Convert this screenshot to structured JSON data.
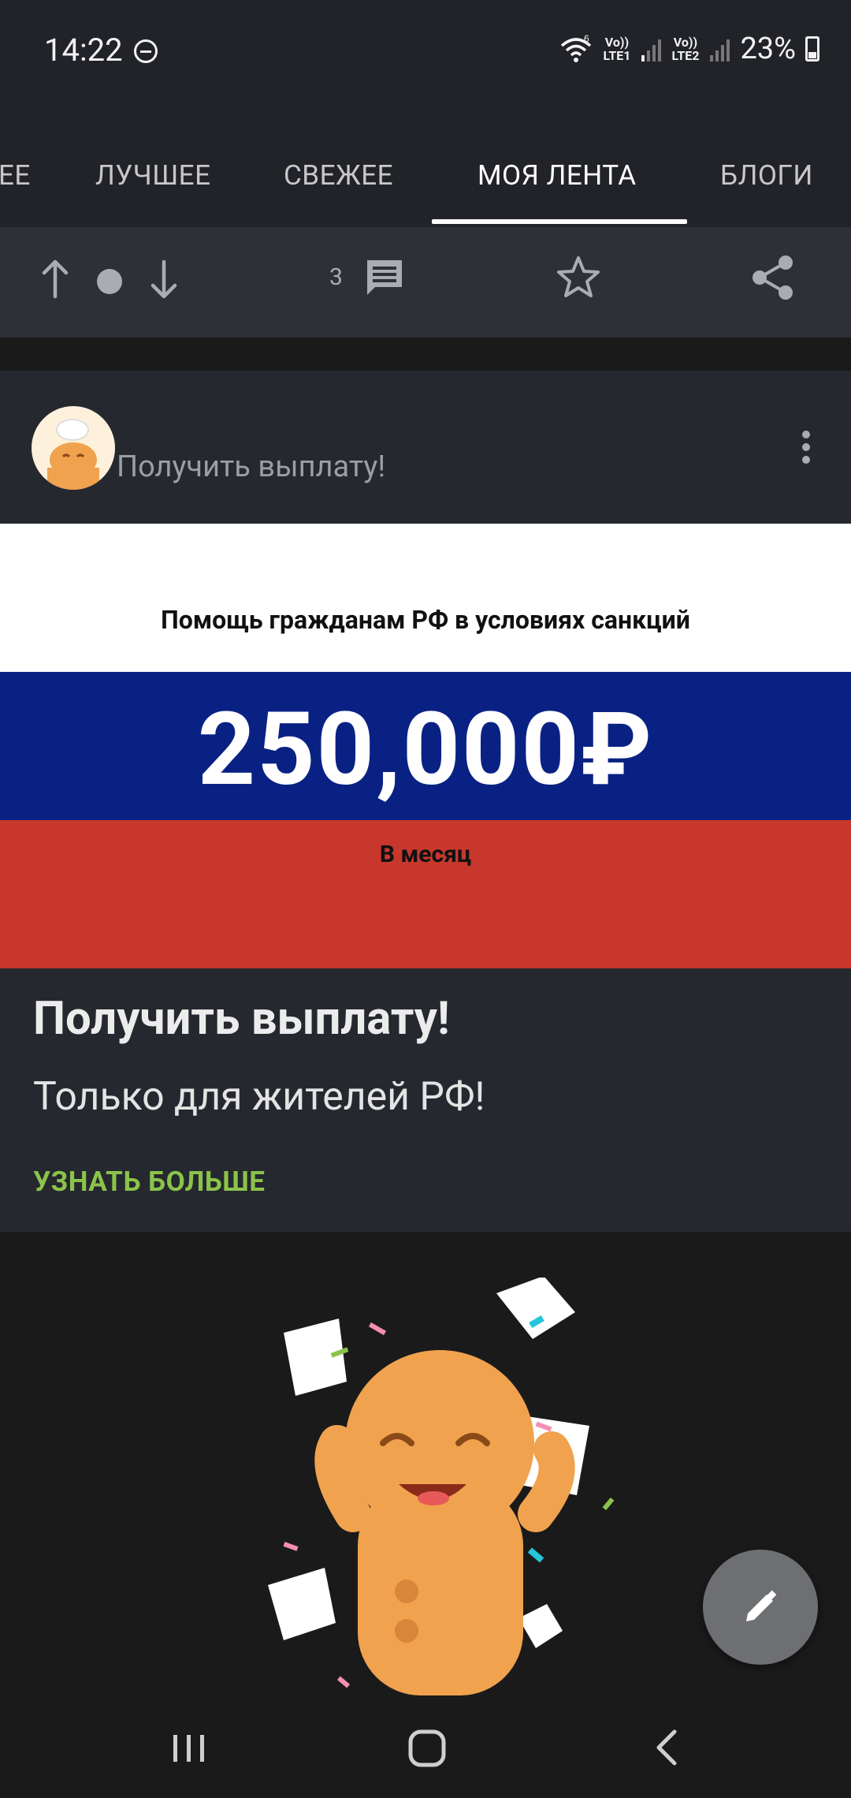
{
  "status_bar": {
    "time": "14:22",
    "sim1": "Vo))\nLTE1",
    "sim2": "Vo))\nLTE2",
    "wifi_badge": "6",
    "battery": "23%"
  },
  "tabs": [
    {
      "label": "ЕЕ",
      "active": false
    },
    {
      "label": "ЛУЧШЕЕ",
      "active": false
    },
    {
      "label": "СВЕЖЕЕ",
      "active": false
    },
    {
      "label": "МОЯ ЛЕНТА",
      "active": true
    },
    {
      "label": "БЛОГИ",
      "active": false
    }
  ],
  "post_actions": {
    "upvote_icon": "arrow-up-icon",
    "rating_icon": "dot-icon",
    "downvote_icon": "arrow-down-icon",
    "comments_count": "3",
    "comments_icon": "comment-icon",
    "save_icon": "star-icon",
    "share_icon": "share-icon"
  },
  "ad": {
    "author": "Получить выплату!",
    "banner_headline": "Помощь гражданам РФ в условиях санкций",
    "banner_amount": "250,000₽",
    "banner_sub": "В месяц",
    "title": "Получить выплату!",
    "description": "Только для жителей РФ!",
    "cta": "УЗНАТЬ БОЛЬШЕ"
  },
  "colors": {
    "cta_green": "#8bc34a",
    "flag_white": "#ffffff",
    "flag_blue": "#0a2184",
    "flag_red": "#c7372c",
    "mascot": "#f0a24e"
  }
}
